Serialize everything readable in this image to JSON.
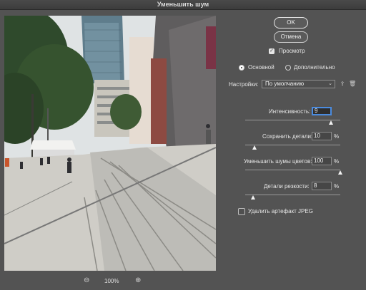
{
  "window": {
    "title": "Уменьшить шум"
  },
  "buttons": {
    "ok": "OK",
    "cancel": "Отмена"
  },
  "preview_checkbox": {
    "label": "Просмотр",
    "checked": true
  },
  "modes": {
    "basic": "Основной",
    "advanced": "Дополнительно",
    "selected": "basic"
  },
  "settings": {
    "label": "Настройки:",
    "value": "По умолчанию"
  },
  "controls": [
    {
      "label": "Интенсивность:",
      "value": "9",
      "unit": "",
      "level": 0.9
    },
    {
      "label": "Сохранить детали:",
      "value": "10",
      "unit": "%",
      "level": 0.1
    },
    {
      "label": "Уменьшить шумы цветов:",
      "value": "100",
      "unit": "%",
      "level": 1.0
    },
    {
      "label": "Детали резкости:",
      "value": "8",
      "unit": "%",
      "level": 0.08
    }
  ],
  "jpeg_checkbox": {
    "label": "Удалить артефакт JPEG",
    "checked": false
  },
  "zoom": {
    "value": "100%",
    "zoom_out_icon": "zoom-out-icon",
    "zoom_in_icon": "zoom-in-icon"
  },
  "colors": {
    "background": "#535353",
    "focus": "#4b8ce0"
  }
}
